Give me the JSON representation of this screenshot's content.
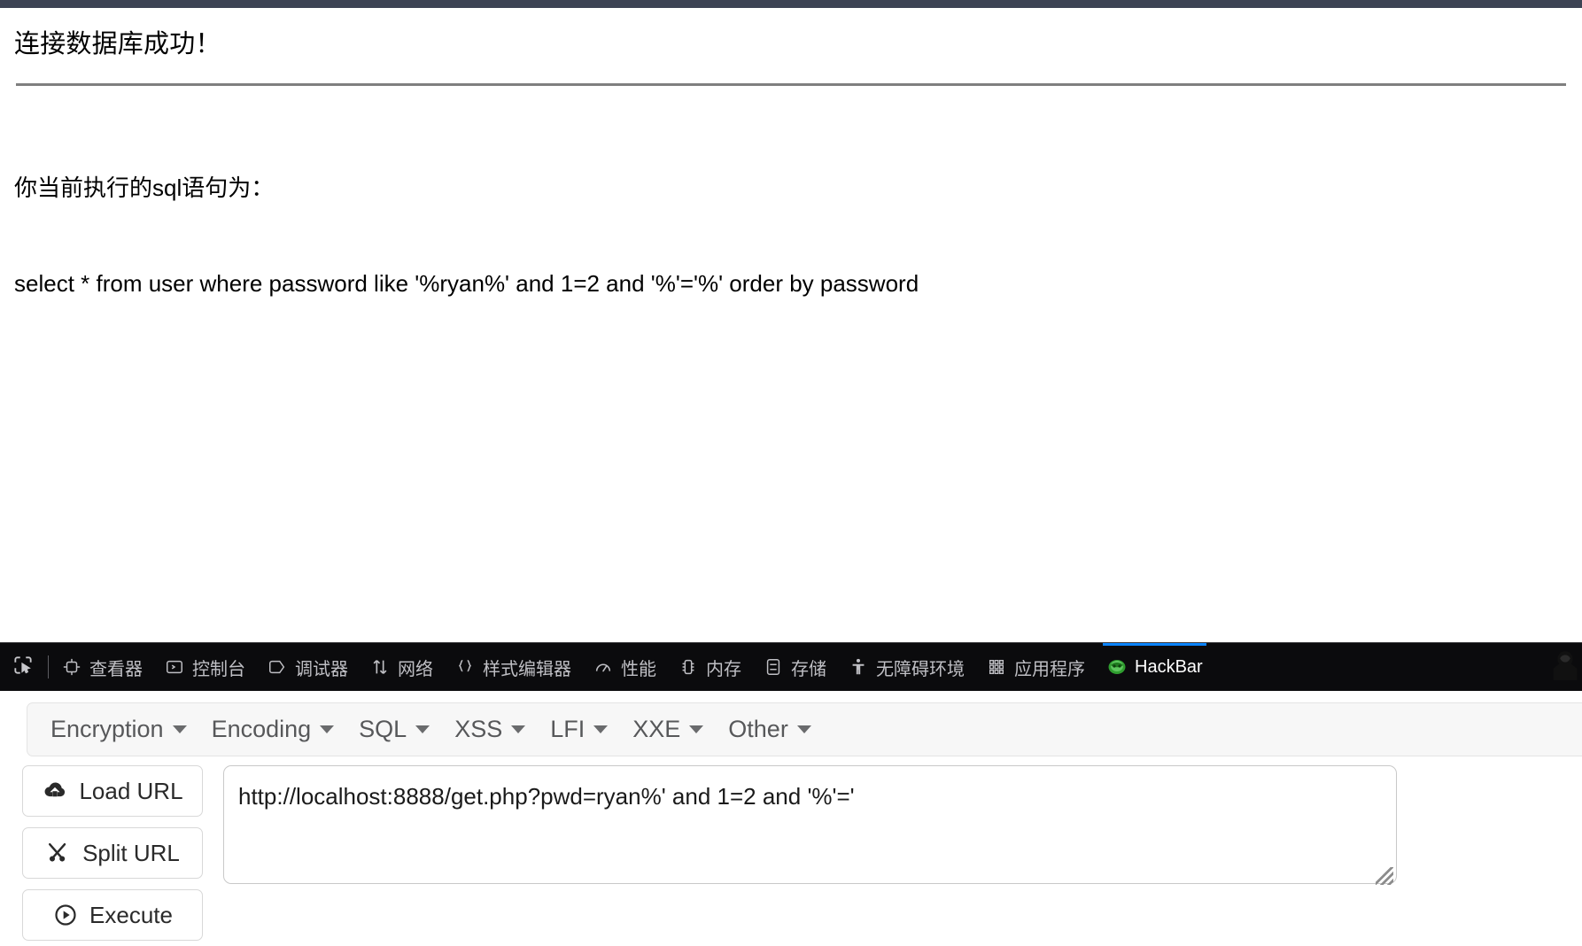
{
  "browser": {
    "chrome_bar_color": "#3d4354"
  },
  "page": {
    "heading": "连接数据库成功！",
    "sql_intro": "你当前执行的sql语句为：",
    "sql_statement": "select * from user where password like '%ryan%' and 1=2 and '%'='%' order by password"
  },
  "devtools": {
    "picker_icon": "element-picker-icon",
    "accent_color": "#0a84ff",
    "tabs": [
      {
        "label": "查看器",
        "icon": "inspector-icon",
        "active": false
      },
      {
        "label": "控制台",
        "icon": "console-icon",
        "active": false
      },
      {
        "label": "调试器",
        "icon": "debugger-icon",
        "active": false
      },
      {
        "label": "网络",
        "icon": "network-icon",
        "active": false
      },
      {
        "label": "样式编辑器",
        "icon": "style-editor-icon",
        "active": false
      },
      {
        "label": "性能",
        "icon": "performance-icon",
        "active": false
      },
      {
        "label": "内存",
        "icon": "memory-icon",
        "active": false
      },
      {
        "label": "存储",
        "icon": "storage-icon",
        "active": false
      },
      {
        "label": "无障碍环境",
        "icon": "accessibility-icon",
        "active": false
      },
      {
        "label": "应用程序",
        "icon": "application-icon",
        "active": false
      },
      {
        "label": "HackBar",
        "icon": "hackbar-logo-icon",
        "active": true
      }
    ],
    "right_icon": "hacker-hoodie-icon"
  },
  "hackbar": {
    "menus": [
      {
        "label": "Encryption"
      },
      {
        "label": "Encoding"
      },
      {
        "label": "SQL"
      },
      {
        "label": "XSS"
      },
      {
        "label": "LFI"
      },
      {
        "label": "XXE"
      },
      {
        "label": "Other"
      }
    ],
    "buttons": [
      {
        "label": "Load URL",
        "icon": "cloud-download-icon"
      },
      {
        "label": "Split URL",
        "icon": "scissors-icon"
      },
      {
        "label": "Execute",
        "icon": "play-circle-icon"
      }
    ],
    "url_field": {
      "value": "http://localhost:8888/get.php?pwd=ryan%' and 1=2 and '%'='",
      "placeholder": "URL"
    }
  }
}
